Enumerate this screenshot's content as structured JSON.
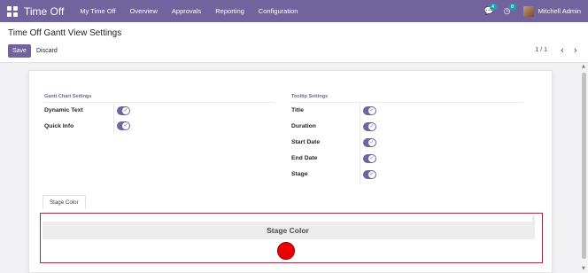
{
  "navbar": {
    "app_name": "Time Off",
    "menu": [
      "My Time Off",
      "Overview",
      "Approvals",
      "Reporting",
      "Configuration"
    ],
    "messages_count": "4",
    "activities_count": "8",
    "user_name": "Mitchell Admin",
    "colors": {
      "navbar": "#71639e",
      "badge": "#1ea3a2"
    }
  },
  "control": {
    "title": "Time Off Gantt View Settings",
    "save_label": "Save",
    "discard_label": "Discard",
    "pager": "1 / 1",
    "prev_icon": "‹",
    "next_icon": "›"
  },
  "form": {
    "gantt_group": {
      "title": "Gantt Chart Settings",
      "fields": [
        {
          "label": "Dynamic Text",
          "value": true
        },
        {
          "label": "Quick Info",
          "value": true
        }
      ]
    },
    "tooltip_group": {
      "title": "Tooltip Settings",
      "fields": [
        {
          "label": "Title",
          "value": true
        },
        {
          "label": "Duration",
          "value": true
        },
        {
          "label": "Start Date",
          "value": true
        },
        {
          "label": "End Date",
          "value": true
        },
        {
          "label": "Stage",
          "value": true
        }
      ]
    },
    "tab_label": "Stage Color",
    "stage_color": {
      "header": "Stage Color",
      "color": "#ee0000"
    }
  }
}
